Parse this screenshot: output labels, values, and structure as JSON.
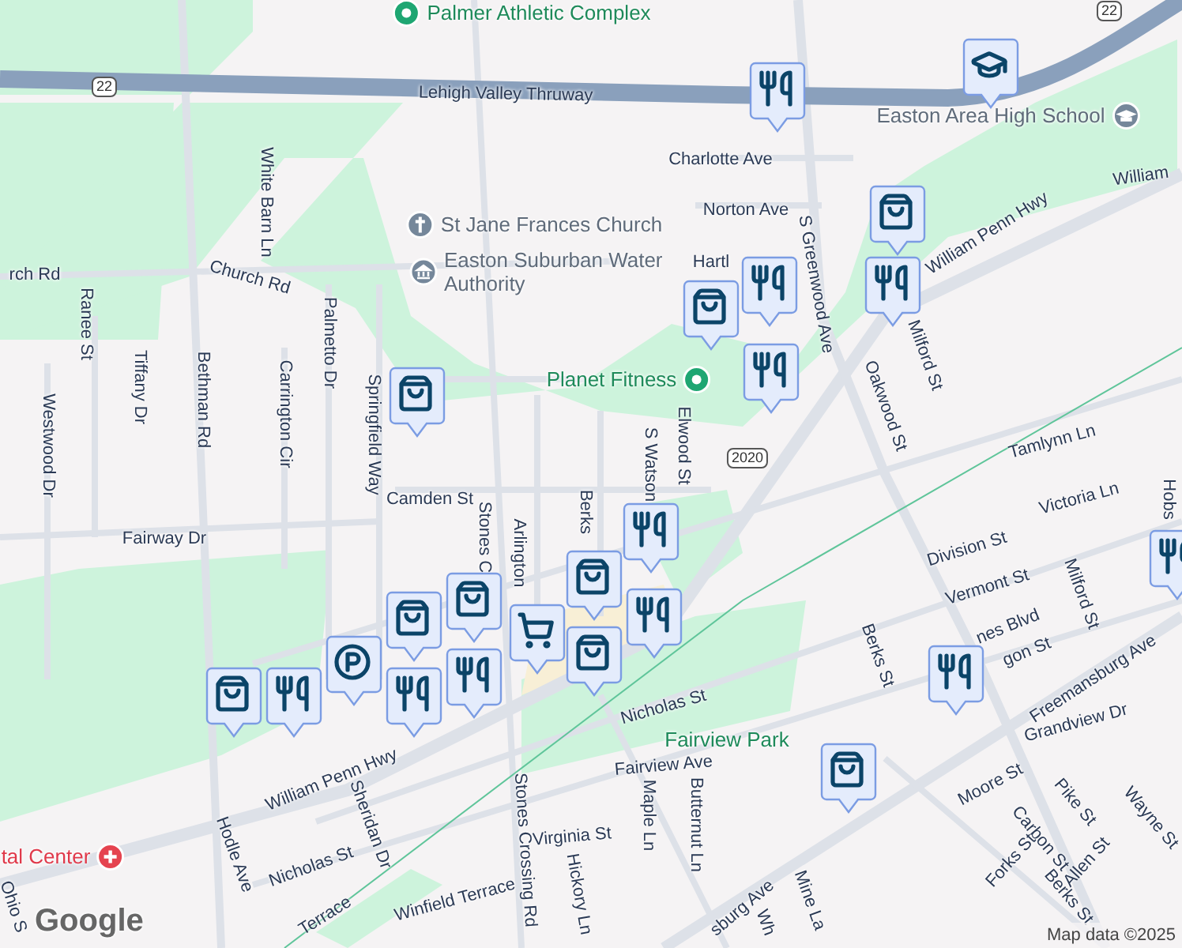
{
  "map": {
    "labels": [
      {
        "text": "Palmer Athletic Complex",
        "kind": "park"
      },
      {
        "text": "22",
        "kind": "shield"
      },
      {
        "text": "22",
        "kind": "shield"
      },
      {
        "text": "Lehigh Valley Thruway",
        "kind": "street"
      },
      {
        "text": "White Barn Ln",
        "kind": "street"
      },
      {
        "text": "rch Rd",
        "kind": "street"
      },
      {
        "text": "Church Rd",
        "kind": "street"
      },
      {
        "text": "Ranee St",
        "kind": "street"
      },
      {
        "text": "Tiffany Dr",
        "kind": "street"
      },
      {
        "text": "Westwood Dr",
        "kind": "street"
      },
      {
        "text": "Bethman Rd",
        "kind": "street"
      },
      {
        "text": "Carrington Cir",
        "kind": "street"
      },
      {
        "text": "Palmetto Dr",
        "kind": "street"
      },
      {
        "text": "Springfield Way",
        "kind": "street"
      },
      {
        "text": "St Jane Frances Church",
        "kind": "church"
      },
      {
        "text": "Easton Suburban Water Authority",
        "kind": "civic"
      },
      {
        "text": "Charlotte Ave",
        "kind": "street"
      },
      {
        "text": "Norton Ave",
        "kind": "street"
      },
      {
        "text": "Hartl",
        "kind": "street"
      },
      {
        "text": "S Greenwood Ave",
        "kind": "street"
      },
      {
        "text": "Planet Fitness",
        "kind": "park"
      },
      {
        "text": "Easton Area High School",
        "kind": "school"
      },
      {
        "text": "William Penn Hwy",
        "kind": "street"
      },
      {
        "text": "William",
        "kind": "street"
      },
      {
        "text": "Milford St",
        "kind": "street"
      },
      {
        "text": "Oakwood St",
        "kind": "street"
      },
      {
        "text": "Tamlynn Ln",
        "kind": "street"
      },
      {
        "text": "Victoria Ln",
        "kind": "street"
      },
      {
        "text": "S Watson",
        "kind": "street"
      },
      {
        "text": "Elwood St",
        "kind": "street"
      },
      {
        "text": "2020",
        "kind": "shield"
      },
      {
        "text": "Camden St",
        "kind": "street"
      },
      {
        "text": "Fairway Dr",
        "kind": "street"
      },
      {
        "text": "Stones C",
        "kind": "street"
      },
      {
        "text": "Arlington",
        "kind": "street"
      },
      {
        "text": "Berks",
        "kind": "street"
      },
      {
        "text": "Division St",
        "kind": "street"
      },
      {
        "text": "Vermont St",
        "kind": "street"
      },
      {
        "text": "nes Blvd",
        "kind": "street"
      },
      {
        "text": "gon St",
        "kind": "street"
      },
      {
        "text": "Milford St",
        "kind": "street"
      },
      {
        "text": "Hobs",
        "kind": "street"
      },
      {
        "text": "Berks St",
        "kind": "street"
      },
      {
        "text": "Freemansburg Ave",
        "kind": "street"
      },
      {
        "text": "Nicholas St",
        "kind": "street"
      },
      {
        "text": "Fairview Park",
        "kind": "park"
      },
      {
        "text": "Grandview Dr",
        "kind": "street"
      },
      {
        "text": "Fairview Ave",
        "kind": "street"
      },
      {
        "text": "Moore St",
        "kind": "street"
      },
      {
        "text": "Pike St",
        "kind": "street"
      },
      {
        "text": "Wayne St",
        "kind": "street"
      },
      {
        "text": "Carbon St",
        "kind": "street"
      },
      {
        "text": "Forks St",
        "kind": "street"
      },
      {
        "text": "Allen St",
        "kind": "street"
      },
      {
        "text": "Berks St",
        "kind": "street"
      },
      {
        "text": "Maple Ln",
        "kind": "street"
      },
      {
        "text": "Butternut Ln",
        "kind": "street"
      },
      {
        "text": "Virginia St",
        "kind": "street"
      },
      {
        "text": "Hickory Ln",
        "kind": "street"
      },
      {
        "text": "Stones Crossing Rd",
        "kind": "street"
      },
      {
        "text": "Winfield Terrace",
        "kind": "street"
      },
      {
        "text": "Terrace",
        "kind": "street"
      },
      {
        "text": "Sheridan Dr",
        "kind": "street"
      },
      {
        "text": "Hodle Ave",
        "kind": "street"
      },
      {
        "text": "William Penn Hwy",
        "kind": "street"
      },
      {
        "text": "Nicholas St",
        "kind": "street"
      },
      {
        "text": "tal Center",
        "kind": "medical"
      },
      {
        "text": "Ohio S",
        "kind": "street"
      },
      {
        "text": "sburg Ave",
        "kind": "street"
      },
      {
        "text": "Mine La",
        "kind": "street"
      },
      {
        "text": "Wh",
        "kind": "street"
      }
    ],
    "markers": [
      {
        "kind": "restaurant"
      },
      {
        "kind": "school"
      },
      {
        "kind": "shopping"
      },
      {
        "kind": "restaurant"
      },
      {
        "kind": "restaurant"
      },
      {
        "kind": "shopping"
      },
      {
        "kind": "restaurant"
      },
      {
        "kind": "shopping"
      },
      {
        "kind": "restaurant"
      },
      {
        "kind": "shopping"
      },
      {
        "kind": "shopping"
      },
      {
        "kind": "grocery"
      },
      {
        "kind": "restaurant"
      },
      {
        "kind": "shopping"
      },
      {
        "kind": "shopping"
      },
      {
        "kind": "restaurant"
      },
      {
        "kind": "parking"
      },
      {
        "kind": "restaurant"
      },
      {
        "kind": "restaurant"
      },
      {
        "kind": "shopping"
      },
      {
        "kind": "restaurant"
      },
      {
        "kind": "shopping"
      },
      {
        "kind": "restaurant"
      }
    ],
    "attribution": "Map data ©2025",
    "logo": "Google"
  }
}
